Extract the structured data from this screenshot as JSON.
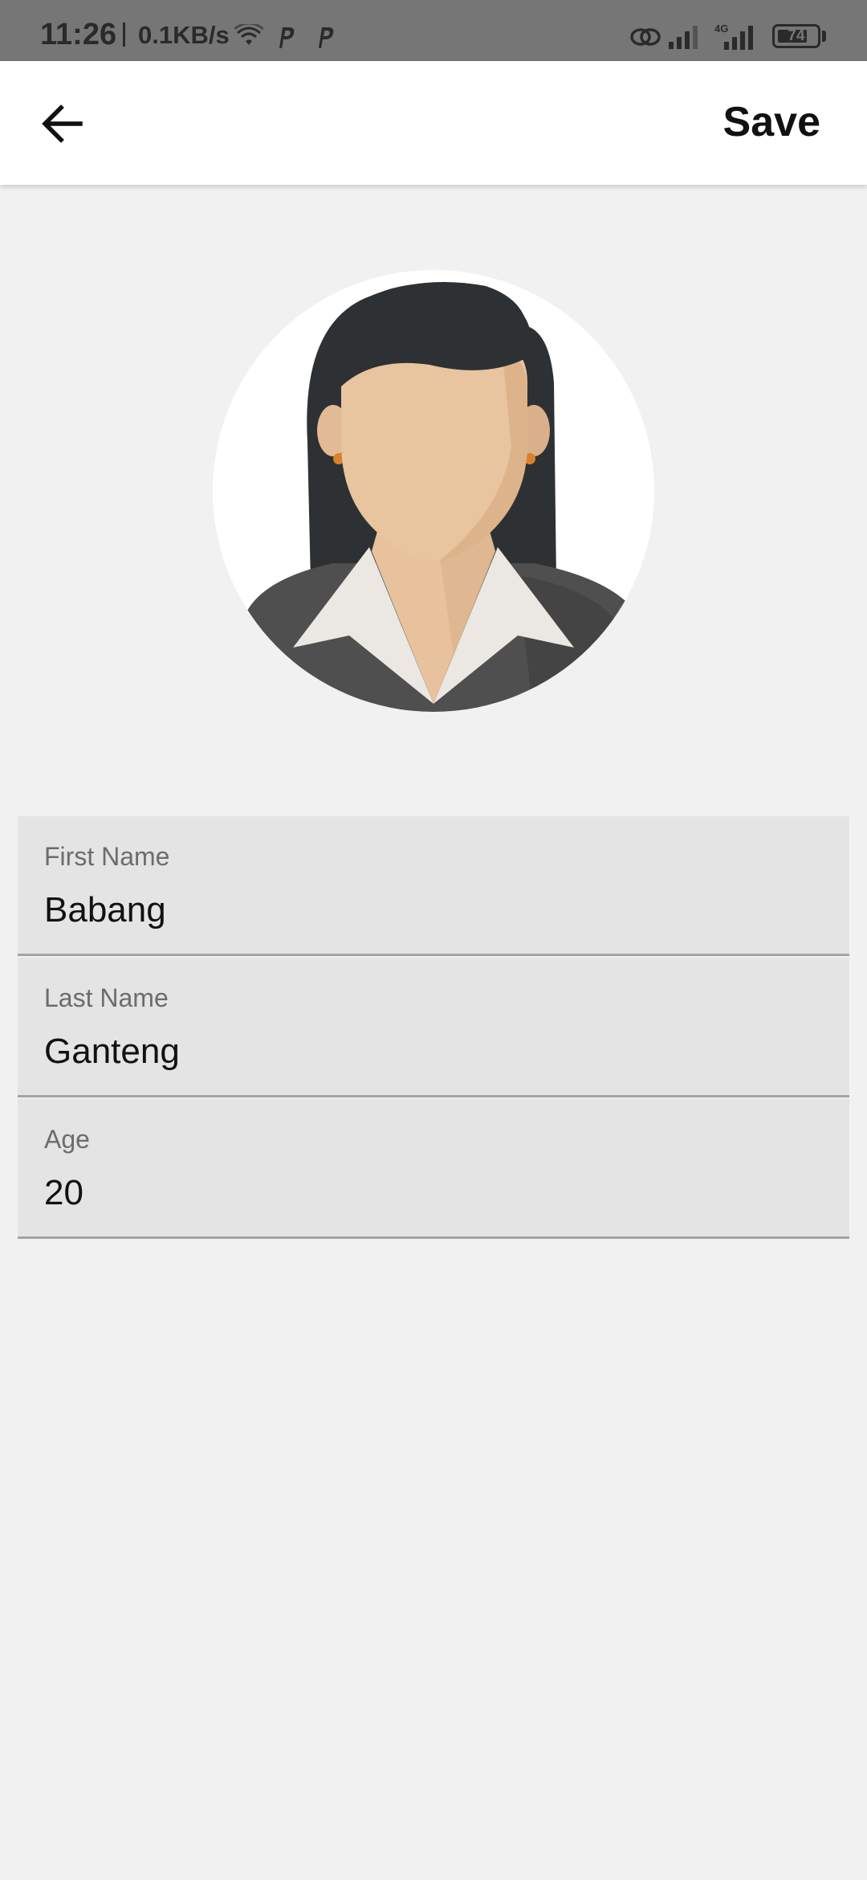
{
  "status_bar": {
    "time": "11:26",
    "speed": "0.1KB/s",
    "network_type": "4G",
    "battery": "74",
    "icons": [
      "wifi-icon",
      "p-notification-icon",
      "p-notification-icon",
      "link-icon",
      "signal-icon",
      "signal-4g-icon",
      "battery-icon"
    ]
  },
  "app_bar": {
    "back_icon": "arrow-left-icon",
    "save_label": "Save"
  },
  "profile": {
    "avatar_icon": "woman-avatar-illustration"
  },
  "form": {
    "fields": [
      {
        "label": "First Name",
        "value": "Babang"
      },
      {
        "label": "Last Name",
        "value": "Ganteng"
      },
      {
        "label": "Age",
        "value": "20"
      }
    ]
  },
  "colors": {
    "status_bar_bg": "#767676",
    "app_bar_bg": "#ffffff",
    "page_bg": "#f1f1f1",
    "field_bg": "#e4e4e4",
    "field_underline": "#a4a4a4"
  }
}
